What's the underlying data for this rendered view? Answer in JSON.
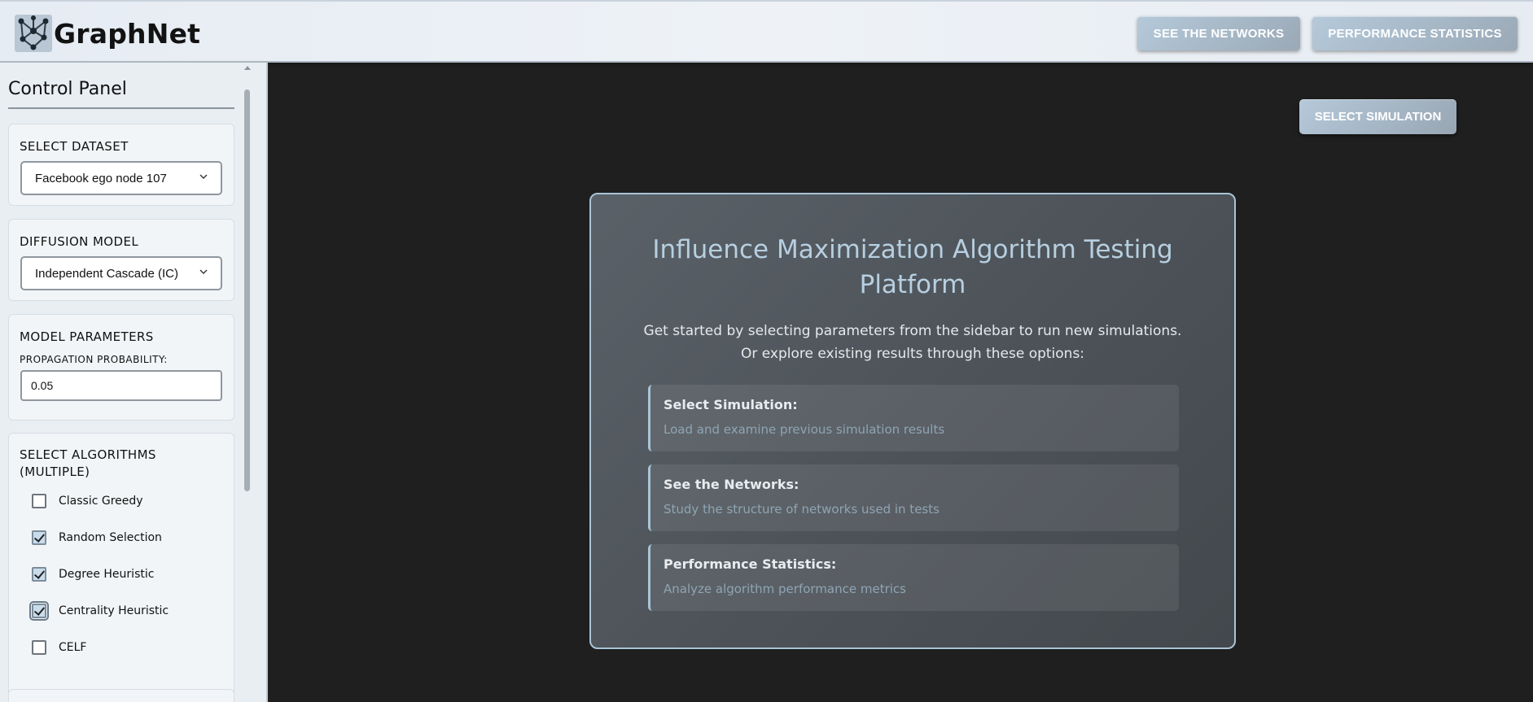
{
  "header": {
    "brand": "GraphNet",
    "buttons": {
      "networks": "SEE THE NETWORKS",
      "performance": "PERFORMANCE STATISTICS"
    }
  },
  "sidebar": {
    "title": "Control Panel",
    "dataset": {
      "heading": "SELECT DATASET",
      "selected": "Facebook ego node 107"
    },
    "diffusion": {
      "heading": "DIFFUSION MODEL",
      "selected": "Independent Cascade (IC)"
    },
    "params": {
      "heading": "MODEL PARAMETERS",
      "prob_label": "PROPAGATION PROBABILITY:",
      "prob_value": "0.05"
    },
    "algorithms": {
      "heading_line1": "SELECT ALGORITHMS",
      "heading_line2": "(MULTIPLE)",
      "items": [
        {
          "label": "Classic Greedy",
          "checked": false
        },
        {
          "label": "Random Selection",
          "checked": true
        },
        {
          "label": "Degree Heuristic",
          "checked": true
        },
        {
          "label": "Centrality Heuristic",
          "checked": true
        },
        {
          "label": "CELF",
          "checked": false
        }
      ]
    }
  },
  "main": {
    "select_simulation_button": "SELECT SIMULATION",
    "panel": {
      "title": "Influence Maximization Algorithm Testing Platform",
      "desc_line1": "Get started by selecting parameters from the sidebar to run new simulations.",
      "desc_line2": "Or explore existing results through these options:",
      "options": [
        {
          "title": "Select Simulation:",
          "desc": "Load and examine previous simulation results"
        },
        {
          "title": "See the Networks:",
          "desc": "Study the structure of networks used in tests"
        },
        {
          "title": "Performance Statistics:",
          "desc": "Analyze algorithm performance metrics"
        }
      ]
    }
  },
  "colors": {
    "accent": "#a9c4d6",
    "button": "#b5c9da",
    "main_bg": "#1f1f1f",
    "title_text": "#b7cfe0"
  },
  "icons": [
    "network-graph-icon",
    "chevron-down-icon",
    "checkmark-icon"
  ]
}
